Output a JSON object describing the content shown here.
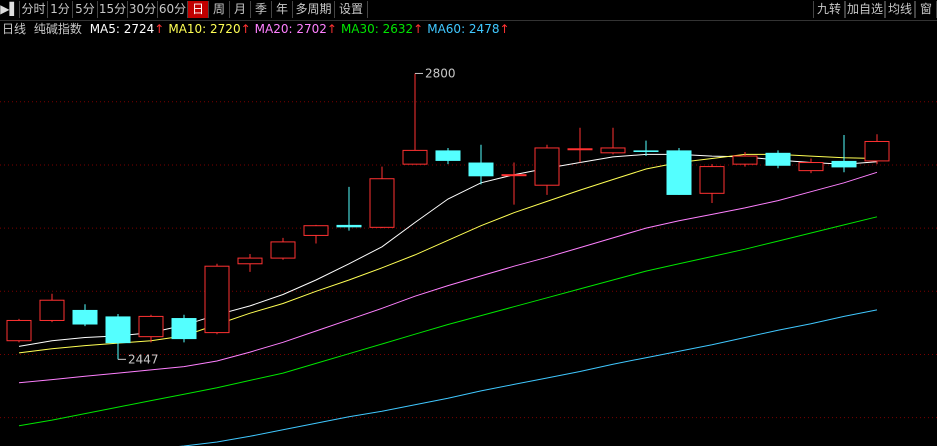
{
  "toolbar": {
    "left_tabs": [
      "分时",
      "1分",
      "5分",
      "15分",
      "30分",
      "60分",
      "日",
      "周",
      "月",
      "季",
      "年",
      "多周期",
      "设置"
    ],
    "active_tab": "日",
    "right_tabs": [
      "九转",
      "加自选",
      "均线",
      "窗"
    ]
  },
  "indicator_bar": {
    "period": "日线",
    "symbol": "纯碱指数",
    "ma": [
      {
        "label": "MA5: 2724",
        "arrow": "↑",
        "color": "#ffffff"
      },
      {
        "label": "MA10: 2720",
        "arrow": "↑",
        "color": "#ffff54"
      },
      {
        "label": "MA20: 2702",
        "arrow": "↑",
        "color": "#ff80ff"
      },
      {
        "label": "MA30: 2632",
        "arrow": "↑",
        "color": "#00e600"
      },
      {
        "label": "MA60: 2478",
        "arrow": "↑",
        "color": "#40c8ff"
      }
    ],
    "arrow_color": "#ff3232"
  },
  "chart_data": {
    "type": "candlestick",
    "ylim": [
      2340,
      2845
    ],
    "gridlines": [
      2765,
      2687,
      2609,
      2531,
      2453,
      2375
    ],
    "annotations": [
      {
        "text": "2800",
        "index": 12,
        "value": 2800
      },
      {
        "text": "2447",
        "index": 3,
        "value": 2447
      }
    ],
    "candles": [
      {
        "open": 2470,
        "close": 2495,
        "high": 2497,
        "low": 2468
      },
      {
        "open": 2495,
        "close": 2520,
        "high": 2528,
        "low": 2493
      },
      {
        "open": 2508,
        "close": 2490,
        "high": 2515,
        "low": 2488
      },
      {
        "open": 2500,
        "close": 2467,
        "high": 2503,
        "low": 2447
      },
      {
        "open": 2475,
        "close": 2500,
        "high": 2502,
        "low": 2468
      },
      {
        "open": 2498,
        "close": 2472,
        "high": 2502,
        "low": 2468
      },
      {
        "open": 2480,
        "close": 2562,
        "high": 2565,
        "low": 2478
      },
      {
        "open": 2565,
        "close": 2572,
        "high": 2577,
        "low": 2555
      },
      {
        "open": 2572,
        "close": 2592,
        "high": 2597,
        "low": 2570
      },
      {
        "open": 2600,
        "close": 2612,
        "high": 2613,
        "low": 2590
      },
      {
        "open": 2613,
        "close": 2610,
        "high": 2660,
        "low": 2606
      },
      {
        "open": 2610,
        "close": 2670,
        "high": 2685,
        "low": 2609
      },
      {
        "open": 2688,
        "close": 2705,
        "high": 2800,
        "low": 2688
      },
      {
        "open": 2705,
        "close": 2692,
        "high": 2708,
        "low": 2688
      },
      {
        "open": 2690,
        "close": 2673,
        "high": 2712,
        "low": 2663
      },
      {
        "open": 2675,
        "close": 2675,
        "high": 2690,
        "low": 2638
      },
      {
        "open": 2662,
        "close": 2708,
        "high": 2712,
        "low": 2650
      },
      {
        "open": 2707,
        "close": 2707,
        "high": 2733,
        "low": 2690
      },
      {
        "open": 2702,
        "close": 2708,
        "high": 2733,
        "low": 2700
      },
      {
        "open": 2705,
        "close": 2703,
        "high": 2717,
        "low": 2698
      },
      {
        "open": 2705,
        "close": 2650,
        "high": 2708,
        "low": 2650
      },
      {
        "open": 2652,
        "close": 2685,
        "high": 2688,
        "low": 2640
      },
      {
        "open": 2688,
        "close": 2698,
        "high": 2703,
        "low": 2685
      },
      {
        "open": 2702,
        "close": 2686,
        "high": 2705,
        "low": 2683
      },
      {
        "open": 2680,
        "close": 2690,
        "high": 2695,
        "low": 2677
      },
      {
        "open": 2692,
        "close": 2684,
        "high": 2724,
        "low": 2678
      },
      {
        "open": 2692,
        "close": 2716,
        "high": 2725,
        "low": 2688
      }
    ],
    "ma_series": [
      {
        "name": "MA5",
        "color": "#ffffff",
        "values": [
          2463,
          2470,
          2474,
          2476,
          2480,
          2489,
          2502,
          2513,
          2527,
          2545,
          2565,
          2586,
          2616,
          2645,
          2665,
          2675,
          2683,
          2690,
          2697,
          2700,
          2700,
          2698,
          2697,
          2693,
          2690,
          2688,
          2691
        ]
      },
      {
        "name": "MA10",
        "color": "#ffff54",
        "values": [
          2455,
          2460,
          2464,
          2467,
          2470,
          2476,
          2490,
          2504,
          2516,
          2531,
          2545,
          2560,
          2576,
          2594,
          2612,
          2628,
          2642,
          2656,
          2669,
          2682,
          2690,
          2695,
          2700,
          2700,
          2698,
          2696,
          2695
        ]
      },
      {
        "name": "MA20",
        "color": "#ff80ff",
        "values": [
          2418,
          2422,
          2426,
          2430,
          2434,
          2438,
          2445,
          2456,
          2468,
          2482,
          2496,
          2510,
          2525,
          2538,
          2550,
          2562,
          2573,
          2585,
          2597,
          2609,
          2618,
          2626,
          2634,
          2643,
          2654,
          2665,
          2678
        ]
      },
      {
        "name": "MA30",
        "color": "#00e600",
        "values": [
          2365,
          2372,
          2380,
          2388,
          2396,
          2404,
          2412,
          2421,
          2430,
          2442,
          2454,
          2466,
          2478,
          2490,
          2501,
          2512,
          2523,
          2534,
          2545,
          2556,
          2565,
          2574,
          2583,
          2593,
          2603,
          2613,
          2623
        ]
      },
      {
        "name": "MA60",
        "color": "#40c8ff",
        "values": [
          2315,
          2320,
          2325,
          2330,
          2336,
          2340,
          2345,
          2352,
          2360,
          2368,
          2376,
          2383,
          2391,
          2399,
          2408,
          2416,
          2424,
          2432,
          2441,
          2449,
          2457,
          2465,
          2474,
          2483,
          2491,
          2500,
          2508
        ]
      }
    ]
  }
}
